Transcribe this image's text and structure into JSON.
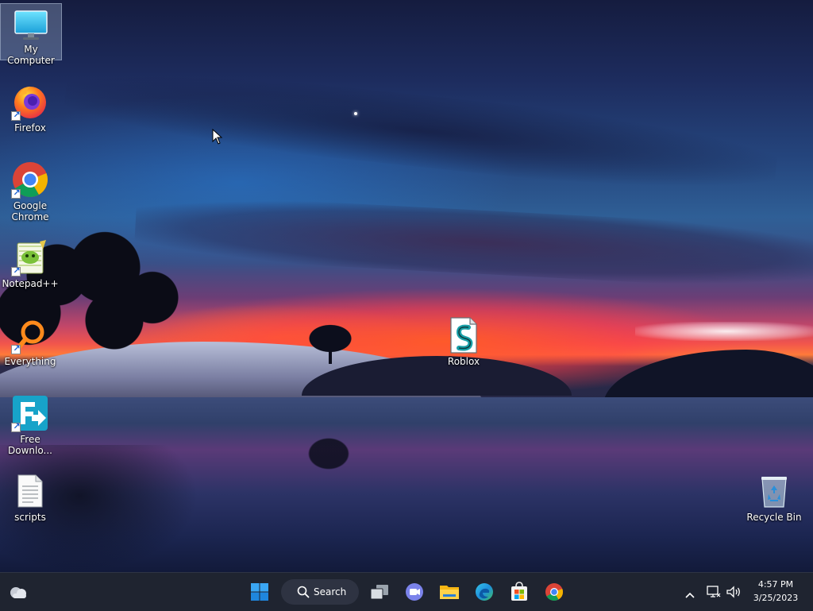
{
  "desktop": {
    "icons": [
      {
        "id": "my-computer",
        "label": "My Computer",
        "icon": "monitor-icon",
        "shortcut": false,
        "selected": true
      },
      {
        "id": "firefox",
        "label": "Firefox",
        "icon": "firefox-icon",
        "shortcut": true
      },
      {
        "id": "chrome",
        "label": "Google Chrome",
        "icon": "chrome-icon",
        "shortcut": true
      },
      {
        "id": "notepadpp",
        "label": "Notepad++",
        "icon": "notepadpp-icon",
        "shortcut": true
      },
      {
        "id": "everything",
        "label": "Everything",
        "icon": "everything-search-icon",
        "shortcut": true
      },
      {
        "id": "free-download",
        "label": "Free Downlo...",
        "icon": "free-download-manager-icon",
        "shortcut": true
      },
      {
        "id": "scripts",
        "label": "scripts",
        "icon": "text-file-icon",
        "shortcut": false
      },
      {
        "id": "roblox",
        "label": "Roblox",
        "icon": "script-file-icon",
        "shortcut": false
      },
      {
        "id": "recycle-bin",
        "label": "Recycle Bin",
        "icon": "recycle-bin-icon",
        "shortcut": false
      }
    ]
  },
  "taskbar": {
    "widgets_icon": "weather-cloud-icon",
    "start_icon": "windows-start-icon",
    "search_label": "Search",
    "pinned": [
      {
        "name": "task-view",
        "icon": "task-view-icon"
      },
      {
        "name": "chat",
        "icon": "teams-chat-icon"
      },
      {
        "name": "file-explorer",
        "icon": "file-explorer-icon"
      },
      {
        "name": "edge",
        "icon": "edge-icon"
      },
      {
        "name": "store",
        "icon": "microsoft-store-icon"
      },
      {
        "name": "chrome",
        "icon": "chrome-icon"
      }
    ],
    "tray": {
      "overflow_icon": "chevron-up-icon",
      "network_icon": "network-icon",
      "volume_icon": "volume-icon",
      "time": "4:57 PM",
      "date": "3/25/2023"
    }
  },
  "colors": {
    "taskbar_bg": "#1f2430",
    "windows_blue": "#2a8fe6",
    "text": "#ffffff"
  }
}
